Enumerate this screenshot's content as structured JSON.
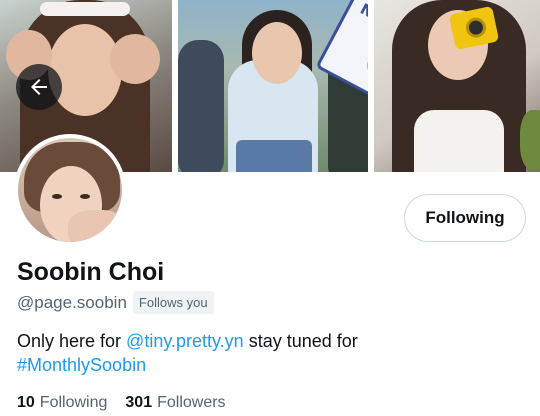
{
  "profile": {
    "display_name": "Soobin Choi",
    "handle": "@page.soobin",
    "follows_you_label": "Follows you",
    "follow_button_label": "Following",
    "bio": {
      "prefix": "Only here for ",
      "mention": "@tiny.pretty.yn",
      "middle": " stay tuned for ",
      "hashtag": "#MonthlySoobin"
    },
    "stats": {
      "following_count": "10",
      "following_label": "Following",
      "followers_count": "301",
      "followers_label": "Followers"
    }
  },
  "banner": {
    "sticker_text": "NewJeans"
  },
  "icons": {
    "back": "back-arrow-icon"
  },
  "colors": {
    "link": "#1d9bf0",
    "secondary_text": "#536471",
    "primary_text": "#0f1419",
    "button_border": "#cfd9de",
    "badge_bg": "#eff3f4"
  }
}
